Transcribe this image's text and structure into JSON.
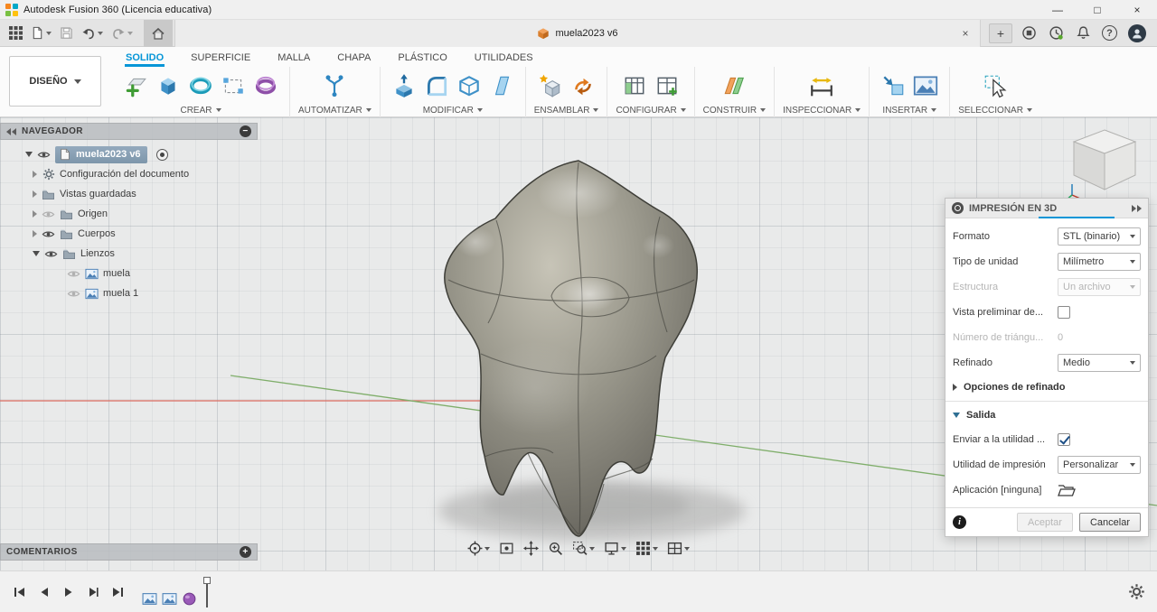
{
  "colors": {
    "accent": "#0696d7",
    "selection": "#7d96ab"
  },
  "titlebar": {
    "app_title": "Autodesk Fusion 360 (Licencia educativa)",
    "minimize_glyph": "—",
    "maximize_glyph": "□",
    "close_glyph": "×"
  },
  "tabbar": {
    "document_tab_label": "muela2023 v6",
    "close_tab_glyph": "×",
    "new_tab_glyph": "+",
    "help_glyph": "?"
  },
  "workspace": {
    "label": "DISEÑO"
  },
  "ribbon": {
    "tabs": [
      {
        "label": "SOLIDO"
      },
      {
        "label": "SUPERFICIE"
      },
      {
        "label": "MALLA"
      },
      {
        "label": "CHAPA"
      },
      {
        "label": "PLÁSTICO"
      },
      {
        "label": "UTILIDADES"
      }
    ],
    "groups": [
      {
        "label": "CREAR"
      },
      {
        "label": "AUTOMATIZAR"
      },
      {
        "label": "MODIFICAR"
      },
      {
        "label": "ENSAMBLAR"
      },
      {
        "label": "CONFIGURAR"
      },
      {
        "label": "CONSTRUIR"
      },
      {
        "label": "INSPECCIONAR"
      },
      {
        "label": "INSERTAR"
      },
      {
        "label": "SELECCIONAR"
      }
    ]
  },
  "navigator": {
    "title": "NAVEGADOR",
    "collapse_glyph": "−",
    "root": {
      "label": "muela2023 v6"
    },
    "items": [
      {
        "label": "Configuración del documento"
      },
      {
        "label": "Vistas guardadas"
      },
      {
        "label": "Origen"
      },
      {
        "label": "Cuerpos"
      },
      {
        "label": "Lienzos"
      }
    ],
    "canvases": [
      {
        "label": "muela"
      },
      {
        "label": "muela 1"
      }
    ]
  },
  "comments": {
    "title": "COMENTARIOS",
    "expand_glyph": "+"
  },
  "dialog": {
    "title": "IMPRESIÓN EN 3D",
    "rows": [
      {
        "label": "Formato",
        "value": "STL (binario)"
      },
      {
        "label": "Tipo de unidad",
        "value": "Milímetro"
      },
      {
        "label": "Estructura",
        "value": "Un archivo"
      },
      {
        "label": "Vista preliminar de..."
      },
      {
        "label": "Número de triángu...",
        "value": "0"
      },
      {
        "label": "Refinado",
        "value": "Medio"
      }
    ],
    "refine_section": "Opciones de refinado",
    "output_section": "Salida",
    "output_rows": [
      {
        "label": "Enviar a la utilidad ..."
      },
      {
        "label": "Utilidad de impresión",
        "value": "Personalizar"
      },
      {
        "label": "Aplicación [ninguna]"
      }
    ],
    "ok_label": "Aceptar",
    "cancel_label": "Cancelar"
  }
}
